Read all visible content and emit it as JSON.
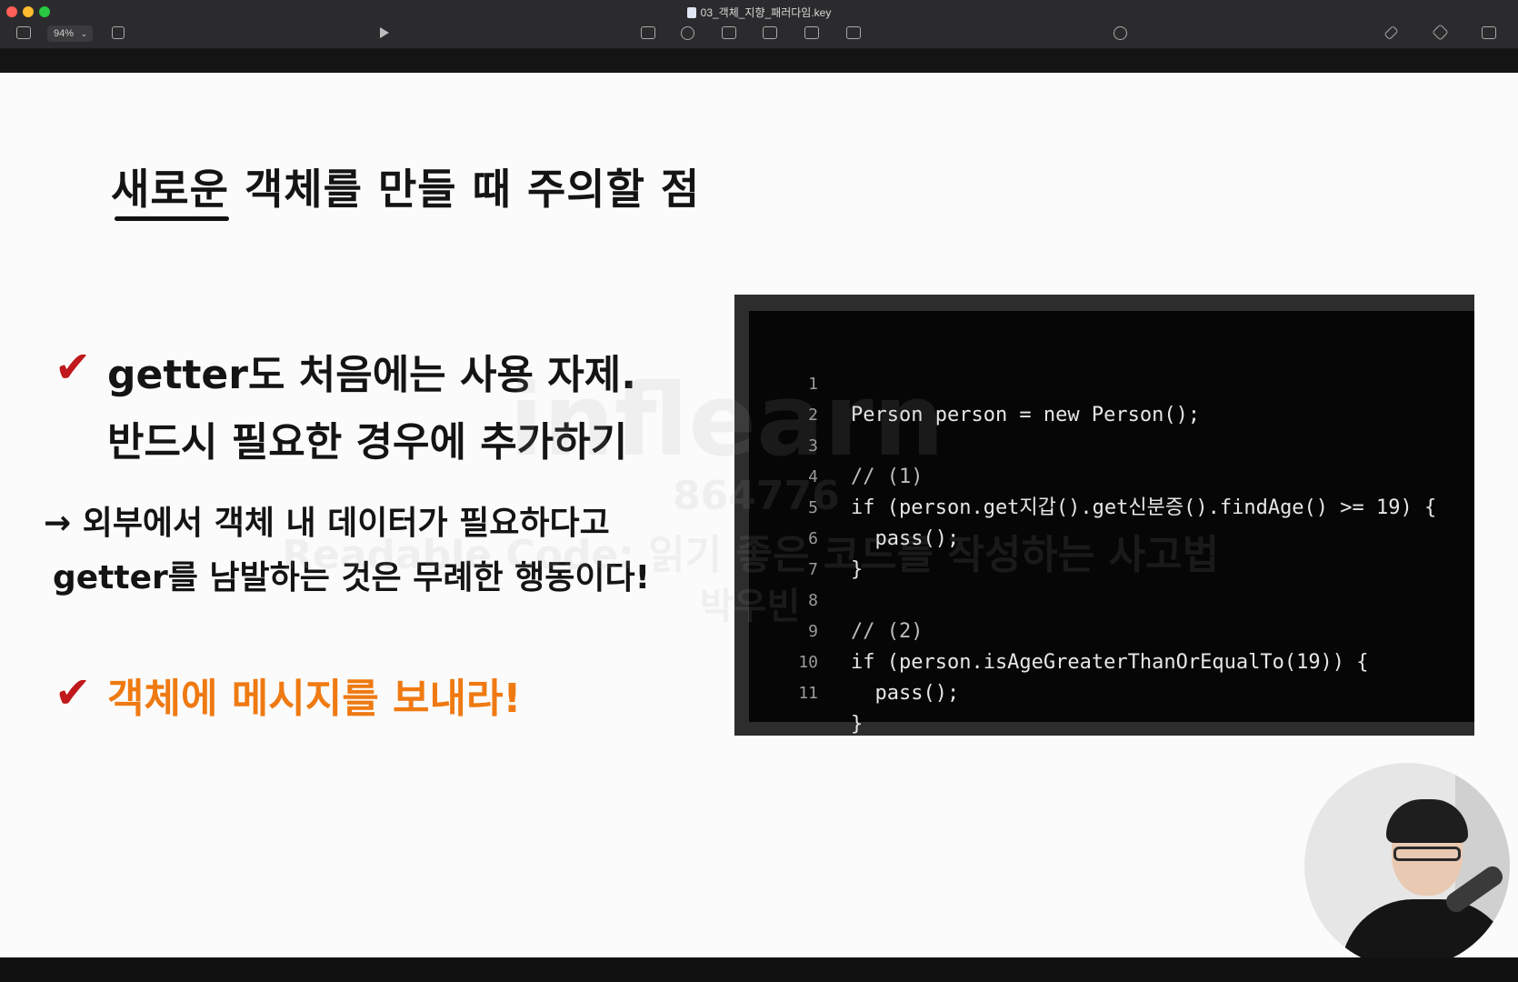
{
  "window": {
    "title": "03_객체_지향_패러다임.key",
    "zoom": "94%"
  },
  "toolbar": {
    "icons": [
      "sidebar-icon",
      "add-slide-icon",
      "play-icon",
      "table-icon",
      "chart-icon",
      "text-icon",
      "shape-icon",
      "media-icon",
      "comment-icon",
      "collaborate-icon",
      "format-icon",
      "animate-icon",
      "document-icon"
    ]
  },
  "slide": {
    "title": "새로운 객체를 만들 때 주의할 점",
    "points": [
      {
        "lines": [
          "getter도 처음에는 사용 자제.",
          "반드시 필요한 경우에 추가하기"
        ]
      }
    ],
    "sub_lines": [
      "→ 외부에서 객체 내 데이터가 필요하다고",
      "getter를 남발하는 것은 무례한 행동이다!"
    ],
    "highlight": "객체에 메시지를 보내라!",
    "check_mark": "✔",
    "colors": {
      "check": "#c0181b",
      "highlight": "#ef7a12"
    }
  },
  "code": {
    "line_numbers": [
      "1",
      "2",
      "3",
      "4",
      "5",
      "6",
      "7",
      "8",
      "9",
      "10",
      "11"
    ],
    "lines": [
      "Person person = new Person();",
      "",
      "// (1)",
      "if (person.get지갑().get신분증().findAge() >= 19) {",
      "  pass();",
      "}",
      "",
      "// (2)",
      "if (person.isAgeGreaterThanOrEqualTo(19)) {",
      "  pass();",
      "}"
    ]
  },
  "watermark": {
    "brand": "inflearn",
    "id": "864776",
    "course": "Readable Code: 읽기 좋은 코드를 작성하는 사고법",
    "instructor": "박우빈"
  }
}
